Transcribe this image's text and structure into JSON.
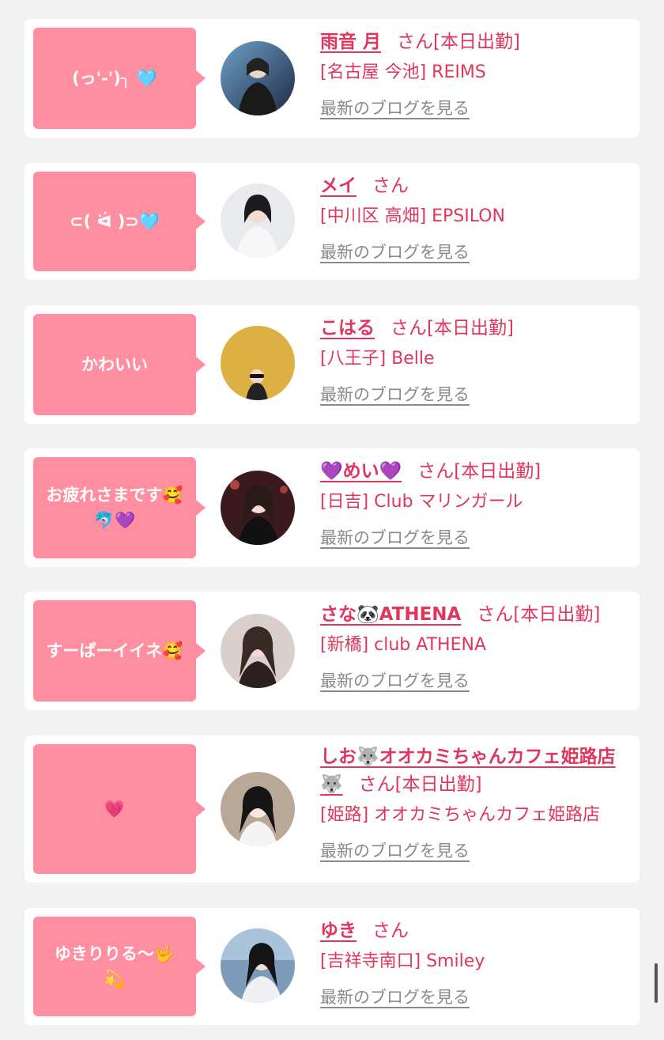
{
  "colors": {
    "accent": "#e0365e",
    "bubble": "#ff8fa0",
    "link_gray": "#8a8a8a"
  },
  "san_label": "さん",
  "blog_label": "最新のブログを見る",
  "cards": [
    {
      "bubble": "(っ'-')╮ 🩵",
      "name": "雨音 月",
      "status": "[本日出勤]",
      "shop": "[名古屋 今池] REIMS"
    },
    {
      "bubble": "⊂( ᐛ )⊃🩵",
      "name": "メイ",
      "status": "",
      "shop": "[中川区 高畑] EPSILON"
    },
    {
      "bubble": "かわいい",
      "name": "こはる",
      "status": "[本日出勤]",
      "shop": "[八王子] Belle"
    },
    {
      "bubble": "お疲れさまです🥰\n🐬💜",
      "name": "💜めい💜",
      "status": "[本日出勤]",
      "shop": "[日吉] Club マリンガール"
    },
    {
      "bubble": "すーぱーイイネ🥰",
      "name": "さな🐼ATHENA",
      "status": "[本日出勤]",
      "shop": "[新橋] club ATHENA"
    },
    {
      "bubble": "💗",
      "name": "しお🐺オオカミちゃんカフェ姫路店🐺",
      "status": "[本日出勤]",
      "shop": "[姫路] オオカミちゃんカフェ姫路店"
    },
    {
      "bubble": "ゆきりりる〜🤟\n💫",
      "name": "ゆき",
      "status": "",
      "shop": "[吉祥寺南口] Smiley"
    }
  ]
}
